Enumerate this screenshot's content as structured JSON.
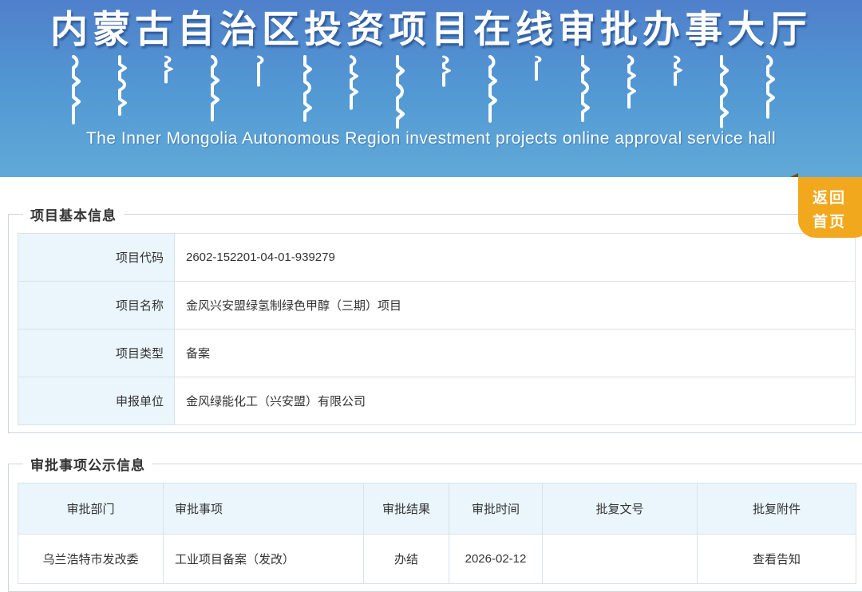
{
  "banner": {
    "title_cn": "内蒙古自治区投资项目在线审批办事大厅",
    "subtitle_en": "The Inner Mongolia Autonomous Region investment projects online approval service hall"
  },
  "home_button": {
    "line1": "返回",
    "line2": "首页"
  },
  "basic_info": {
    "section_title": "项目基本信息",
    "rows": [
      {
        "label": "项目代码",
        "value": "2602-152201-04-01-939279"
      },
      {
        "label": "项目名称",
        "value": "金风兴安盟绿氢制绿色甲醇（三期）项目"
      },
      {
        "label": "项目类型",
        "value": "备案"
      },
      {
        "label": "申报单位",
        "value": "金风绿能化工（兴安盟）有限公司"
      }
    ]
  },
  "approval_info": {
    "section_title": "审批事项公示信息",
    "columns": [
      "审批部门",
      "审批事项",
      "审批结果",
      "审批时间",
      "批复文号",
      "批复附件"
    ],
    "rows": [
      {
        "department": "乌兰浩特市发改委",
        "item": "工业项目备案（发改）",
        "result": "办结",
        "time": "2026-02-12",
        "doc_no": "",
        "attachment": "查看告知"
      }
    ]
  },
  "colors": {
    "banner_top": "#4f80cb",
    "banner_bottom": "#61a9d7",
    "accent_orange": "#f2a81d",
    "header_cell_bg": "#eaf5fc"
  }
}
